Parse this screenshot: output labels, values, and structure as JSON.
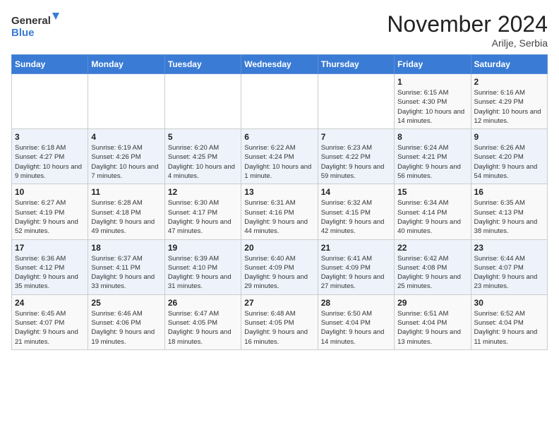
{
  "logo": {
    "general": "General",
    "blue": "Blue"
  },
  "title": "November 2024",
  "location": "Arilje, Serbia",
  "days_of_week": [
    "Sunday",
    "Monday",
    "Tuesday",
    "Wednesday",
    "Thursday",
    "Friday",
    "Saturday"
  ],
  "weeks": [
    [
      {
        "day": "",
        "info": ""
      },
      {
        "day": "",
        "info": ""
      },
      {
        "day": "",
        "info": ""
      },
      {
        "day": "",
        "info": ""
      },
      {
        "day": "",
        "info": ""
      },
      {
        "day": "1",
        "info": "Sunrise: 6:15 AM\nSunset: 4:30 PM\nDaylight: 10 hours and 14 minutes."
      },
      {
        "day": "2",
        "info": "Sunrise: 6:16 AM\nSunset: 4:29 PM\nDaylight: 10 hours and 12 minutes."
      }
    ],
    [
      {
        "day": "3",
        "info": "Sunrise: 6:18 AM\nSunset: 4:27 PM\nDaylight: 10 hours and 9 minutes."
      },
      {
        "day": "4",
        "info": "Sunrise: 6:19 AM\nSunset: 4:26 PM\nDaylight: 10 hours and 7 minutes."
      },
      {
        "day": "5",
        "info": "Sunrise: 6:20 AM\nSunset: 4:25 PM\nDaylight: 10 hours and 4 minutes."
      },
      {
        "day": "6",
        "info": "Sunrise: 6:22 AM\nSunset: 4:24 PM\nDaylight: 10 hours and 1 minute."
      },
      {
        "day": "7",
        "info": "Sunrise: 6:23 AM\nSunset: 4:22 PM\nDaylight: 9 hours and 59 minutes."
      },
      {
        "day": "8",
        "info": "Sunrise: 6:24 AM\nSunset: 4:21 PM\nDaylight: 9 hours and 56 minutes."
      },
      {
        "day": "9",
        "info": "Sunrise: 6:26 AM\nSunset: 4:20 PM\nDaylight: 9 hours and 54 minutes."
      }
    ],
    [
      {
        "day": "10",
        "info": "Sunrise: 6:27 AM\nSunset: 4:19 PM\nDaylight: 9 hours and 52 minutes."
      },
      {
        "day": "11",
        "info": "Sunrise: 6:28 AM\nSunset: 4:18 PM\nDaylight: 9 hours and 49 minutes."
      },
      {
        "day": "12",
        "info": "Sunrise: 6:30 AM\nSunset: 4:17 PM\nDaylight: 9 hours and 47 minutes."
      },
      {
        "day": "13",
        "info": "Sunrise: 6:31 AM\nSunset: 4:16 PM\nDaylight: 9 hours and 44 minutes."
      },
      {
        "day": "14",
        "info": "Sunrise: 6:32 AM\nSunset: 4:15 PM\nDaylight: 9 hours and 42 minutes."
      },
      {
        "day": "15",
        "info": "Sunrise: 6:34 AM\nSunset: 4:14 PM\nDaylight: 9 hours and 40 minutes."
      },
      {
        "day": "16",
        "info": "Sunrise: 6:35 AM\nSunset: 4:13 PM\nDaylight: 9 hours and 38 minutes."
      }
    ],
    [
      {
        "day": "17",
        "info": "Sunrise: 6:36 AM\nSunset: 4:12 PM\nDaylight: 9 hours and 35 minutes."
      },
      {
        "day": "18",
        "info": "Sunrise: 6:37 AM\nSunset: 4:11 PM\nDaylight: 9 hours and 33 minutes."
      },
      {
        "day": "19",
        "info": "Sunrise: 6:39 AM\nSunset: 4:10 PM\nDaylight: 9 hours and 31 minutes."
      },
      {
        "day": "20",
        "info": "Sunrise: 6:40 AM\nSunset: 4:09 PM\nDaylight: 9 hours and 29 minutes."
      },
      {
        "day": "21",
        "info": "Sunrise: 6:41 AM\nSunset: 4:09 PM\nDaylight: 9 hours and 27 minutes."
      },
      {
        "day": "22",
        "info": "Sunrise: 6:42 AM\nSunset: 4:08 PM\nDaylight: 9 hours and 25 minutes."
      },
      {
        "day": "23",
        "info": "Sunrise: 6:44 AM\nSunset: 4:07 PM\nDaylight: 9 hours and 23 minutes."
      }
    ],
    [
      {
        "day": "24",
        "info": "Sunrise: 6:45 AM\nSunset: 4:07 PM\nDaylight: 9 hours and 21 minutes."
      },
      {
        "day": "25",
        "info": "Sunrise: 6:46 AM\nSunset: 4:06 PM\nDaylight: 9 hours and 19 minutes."
      },
      {
        "day": "26",
        "info": "Sunrise: 6:47 AM\nSunset: 4:05 PM\nDaylight: 9 hours and 18 minutes."
      },
      {
        "day": "27",
        "info": "Sunrise: 6:48 AM\nSunset: 4:05 PM\nDaylight: 9 hours and 16 minutes."
      },
      {
        "day": "28",
        "info": "Sunrise: 6:50 AM\nSunset: 4:04 PM\nDaylight: 9 hours and 14 minutes."
      },
      {
        "day": "29",
        "info": "Sunrise: 6:51 AM\nSunset: 4:04 PM\nDaylight: 9 hours and 13 minutes."
      },
      {
        "day": "30",
        "info": "Sunrise: 6:52 AM\nSunset: 4:04 PM\nDaylight: 9 hours and 11 minutes."
      }
    ]
  ]
}
